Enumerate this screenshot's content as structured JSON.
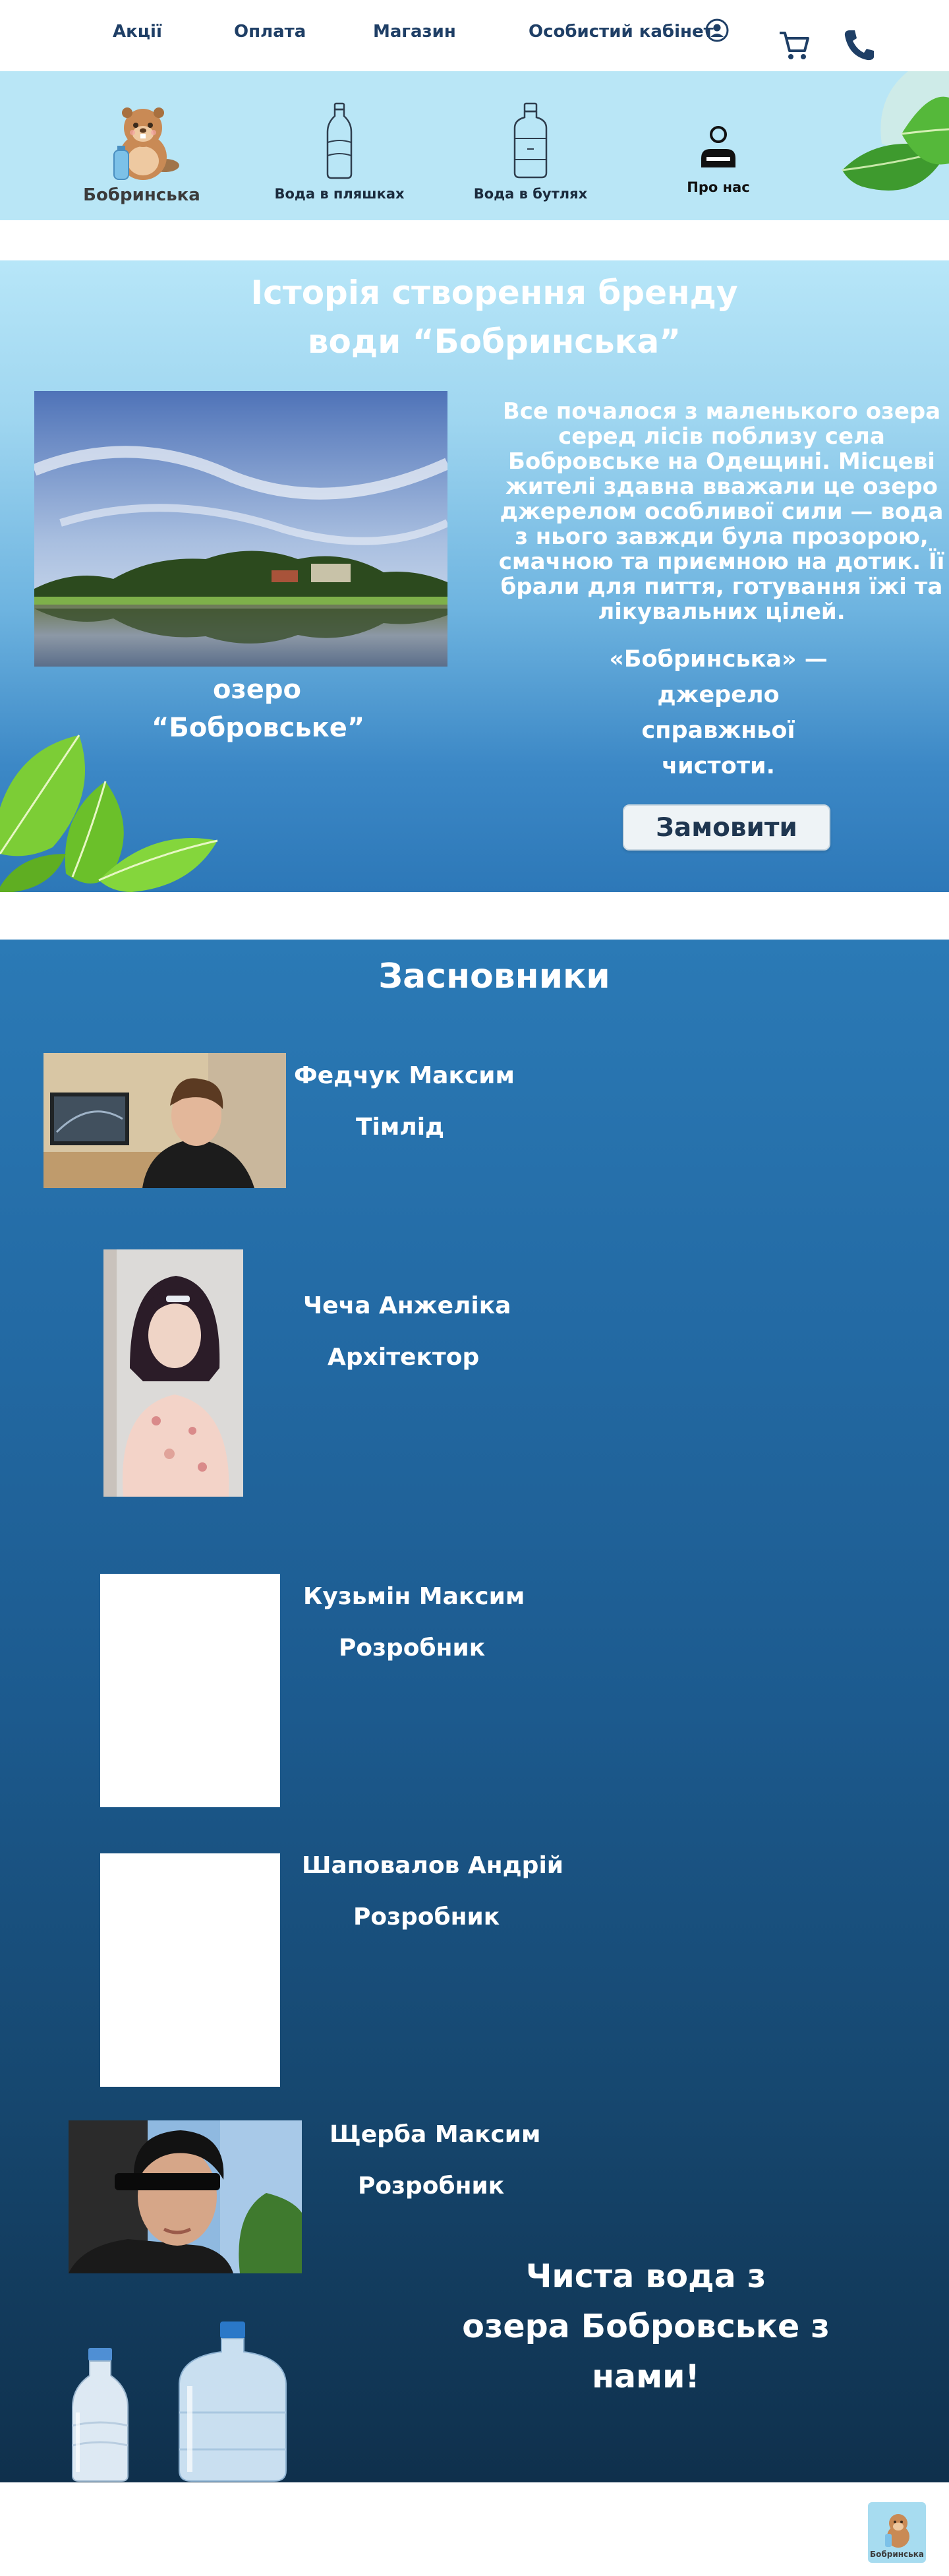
{
  "nav": {
    "links": [
      "Акції",
      "Оплата",
      "Магазин",
      "Особистий кабінет"
    ],
    "icons": [
      "user-circle-icon",
      "cart-icon",
      "phone-icon"
    ]
  },
  "categories": [
    {
      "label": "Бобринська",
      "icon": "beaver-logo"
    },
    {
      "label": "Вода в пляшках",
      "icon": "bottle-icon"
    },
    {
      "label": "Вода в бутлях",
      "icon": "jug-icon"
    },
    {
      "label": "Про нас",
      "icon": "person-icon"
    }
  ],
  "history": {
    "title_line1": "Історія створення бренду",
    "title_line2": "води “Бобринська”",
    "paragraph": "Все почалося з маленького озера серед лісів поблизу села Бобровське на Одещині. Місцеві жителі здавна вважали це озеро джерелом особливої сили — вода з нього завжди була прозорою, смачною та приємною на дотик. Її брали для пиття, готування їжі та лікувальних цілей.",
    "quote": "«Бобринська» — джерело справжньої чистоти.",
    "caption": "озеро “Бобровське”",
    "order_button": "Замовити"
  },
  "founders": {
    "title": "Засновники",
    "people": [
      {
        "name": "Федчук Максим",
        "role": "Тімлід"
      },
      {
        "name": "Чеча Анжеліка",
        "role": "Архітектор"
      },
      {
        "name": "Кузьмін Максим",
        "role": "Розробник"
      },
      {
        "name": "Шаповалов Андрій",
        "role": "Розробник"
      },
      {
        "name": "Щерба Максим",
        "role": "Розробник"
      }
    ],
    "slogan_line1": "Чиста вода з",
    "slogan_line2": "озера Бобровське з нами!"
  },
  "footer": {
    "logo_label": "Бобринська"
  },
  "colors": {
    "nav_text": "#1f3f66",
    "category_band": "#b9e6f6",
    "accent_dark": "#0f304c"
  }
}
